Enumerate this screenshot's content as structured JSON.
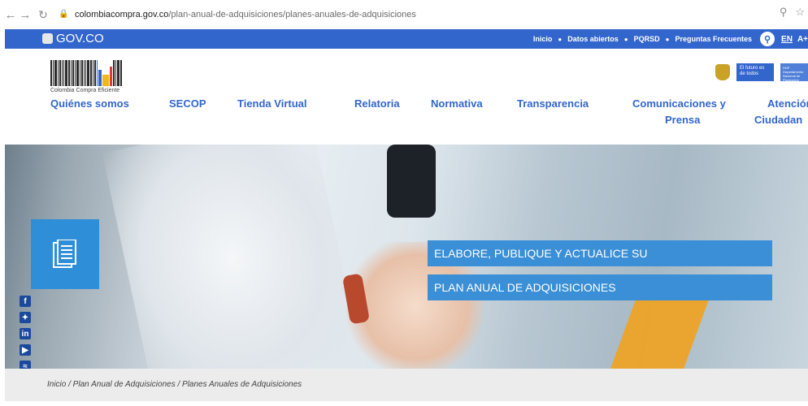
{
  "browser": {
    "url_host": "colombiacompra.gov.co",
    "url_path": "/plan-anual-de-adquisiciones/planes-anuales-de-adquisiciones"
  },
  "gov_bar": {
    "logo_text": "GOV.CO",
    "links": [
      "Inicio",
      "Datos abiertos",
      "PQRSD",
      "Preguntas Frecuentes"
    ],
    "lang": "EN",
    "text_size": "A+"
  },
  "header": {
    "brand_caption": "Colombia Compra Eficiente",
    "futuro_text": "El futuro es de todos",
    "dnp_text": "DNP Departamento Nacional de Planeación"
  },
  "nav": {
    "items": [
      "Quiénes somos",
      "SECOP",
      "Tienda Virtual",
      "Relatoria",
      "Normativa",
      "Transparencia",
      "Comunicaciones y",
      "Prensa",
      "Atención",
      "Ciudadan"
    ]
  },
  "hero": {
    "banner_line1": "ELABORE, PUBLIQUE Y ACTUALICE SU",
    "banner_line2": "PLAN ANUAL DE ADQUISICIONES"
  },
  "breadcrumb": {
    "text": "Inicio / Plan Anual de Adquisiciones / Planes Anuales de Adquisiciones"
  },
  "colors": {
    "gov_blue": "#3366cc",
    "banner_blue": "#3a8fd6",
    "nav_text": "#3366cc"
  }
}
